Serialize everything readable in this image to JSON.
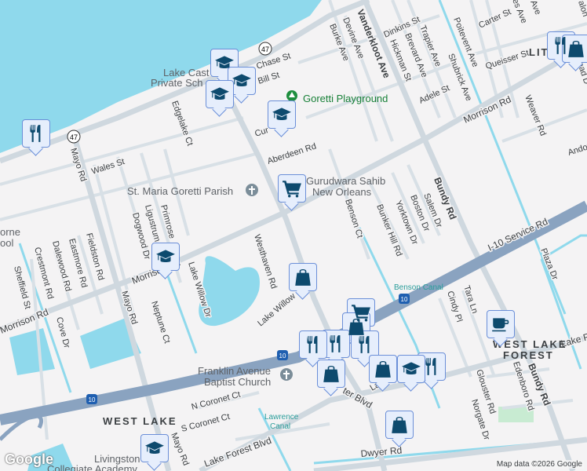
{
  "map": {
    "colors": {
      "water": "#8fd9ec",
      "land": "#f4f3f4",
      "road": "#d5dde3",
      "highway": "#8aa3c0",
      "marker_bg": "#e6eefc",
      "marker_border": "#6b8fd8",
      "icon": "#0d4a6e"
    },
    "streets": {
      "lakeshore_shield": "47",
      "mayo_shield": "47",
      "i10_a": "10",
      "i10_b": "10",
      "i10_c": "10",
      "wales": "Wales St",
      "mayo_n": "Mayo Rd",
      "mayo_s": "Mayo Rd",
      "mayo_ss": "Mayo Rd",
      "edgelake": "Edgelake Ct",
      "chase": "Chase St",
      "bill": "Bill St",
      "cur": "Cur",
      "aberdeen": "Aberdeen Rd",
      "burke": "Burke Ave",
      "devine": "Devine Ave",
      "vanderkloot": "Vanderkloot Ave",
      "dinkins": "Dinkins St",
      "hickman": "Hickman St",
      "brevard": "Brevard Ave",
      "trapier": "Trapier Ave",
      "shubrick": "Shubrick Ave",
      "poitevent": "Poitevent Ave",
      "carter": "Carter St",
      "queisser": "Queisser St",
      "adele": "Adele St",
      "morrison_ne": "Morrison Rd",
      "morrison_mid": "Morrison Rd",
      "morrison_w": "Morrison Rd",
      "weaver": "Weaver Rd",
      "andover": "Andov",
      "bundy_n": "Bundy Rd",
      "bundy_s": "Bundy Rd",
      "benson": "Benson Ct",
      "bunker": "Bunker Hill Rd",
      "yorktown": "Yorktown Dr",
      "boston": "Boston Dr",
      "salem": "Salem Dr",
      "i10_service": "I-10 Service Rd",
      "plaza": "Plaza Dr",
      "dogwood": "Dogwood Dr",
      "ligustrum": "Ligustrum",
      "primrose": "Primrose",
      "westhaven": "Westhaven Rd",
      "lake_willow_dr": "Lake Willow Dr",
      "lake_willow": "Lake Willow",
      "fieldston": "Fieldston Rd",
      "eastmore": "Eastmore Rd",
      "dalewood": "Dalewood Rd",
      "crestmont": "Crestmont Rd",
      "sheffield": "Sheffield St",
      "cove": "Cove Dr",
      "neptune": "Neptune Ct",
      "n_coronet": "N Coronet Ct",
      "s_coronet": "S Coronet Ct",
      "lake_forest_blvd": "Lake Forest Blvd",
      "lake_forest_e": "Lake Fo",
      "dwyer": "Dwyer Rd",
      "tara": "Tara Ln",
      "cindy": "Cindy Pl",
      "glouster": "Glouster Rd",
      "edenboro": "Edenboro Rd",
      "norgate": "Norgate Dr",
      "lake_forest_frag": "La",
      "forest_blvd": "ter Blvd",
      "mead": "ead D",
      "halon": "alon",
      "es_ave": "es Ave",
      "ave": "Ave"
    },
    "places": {
      "lake_castle_1": "Lake Cast",
      "lake_castle_2": "Private Sch",
      "goretti_playground": "Goretti Playground",
      "st_maria": "St. Maria Goretti Parish",
      "gurudwara_1": "Gurudwara Sahib",
      "gurudwara_2": "New Orleans",
      "franklin_1": "Franklin Avenue",
      "franklin_2": "Baptist Church",
      "livingston_1": "Livingston",
      "livingston_2": "Collegiate Academy",
      "horne_1": "orne",
      "horne_2": "ool"
    },
    "areas": {
      "west_lake": "WEST LAKE",
      "west_lake_forest_1": "WEST LAKE",
      "west_lake_forest_2": "FOREST",
      "lit": "LIT"
    },
    "canals": {
      "benson": "Benson Canal",
      "lawrence_1": "Lawrence",
      "lawrence_2": "Canal"
    },
    "attribution": "Map data ©2026 Google",
    "logo": "Google"
  },
  "markers": [
    {
      "icon": "restaurant-icon"
    },
    {
      "icon": "school-icon"
    },
    {
      "icon": "school-icon"
    },
    {
      "icon": "school-icon"
    },
    {
      "icon": "school-icon"
    },
    {
      "icon": "shopping-cart-icon"
    },
    {
      "icon": "school-icon"
    },
    {
      "icon": "shopping-bag-icon"
    },
    {
      "icon": "restaurant-icon"
    },
    {
      "icon": "shopping-bag-icon"
    },
    {
      "icon": "coffee-icon"
    },
    {
      "icon": "shopping-cart-icon"
    },
    {
      "icon": "shopping-bag-icon"
    },
    {
      "icon": "restaurant-icon"
    },
    {
      "icon": "restaurant-icon"
    },
    {
      "icon": "restaurant-icon"
    },
    {
      "icon": "shopping-bag-icon"
    },
    {
      "icon": "shopping-bag-icon"
    },
    {
      "icon": "school-icon"
    },
    {
      "icon": "restaurant-icon"
    },
    {
      "icon": "shopping-bag-icon"
    },
    {
      "icon": "school-icon"
    }
  ]
}
